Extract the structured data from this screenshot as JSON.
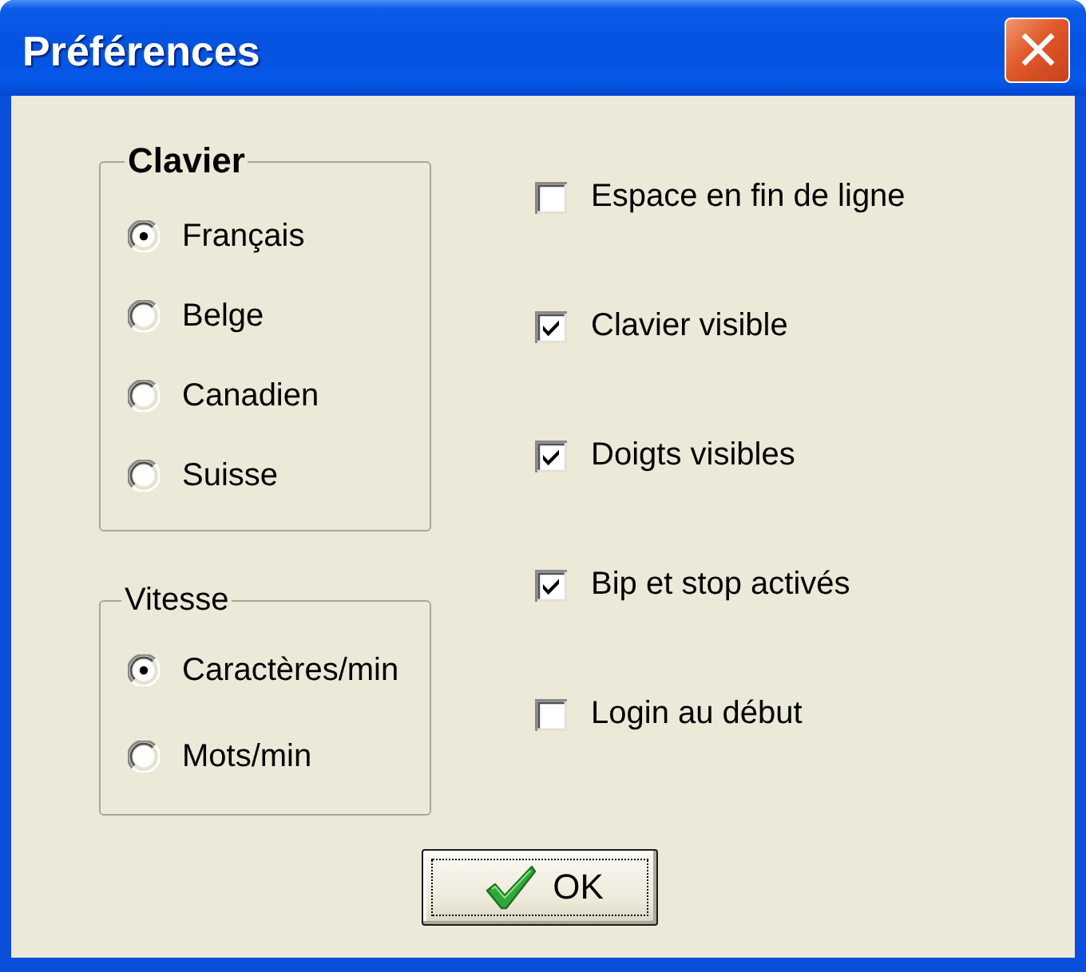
{
  "window": {
    "title": "Préférences"
  },
  "groups": [
    {
      "title": "Clavier",
      "bold": true,
      "options": [
        {
          "label": "Français",
          "selected": true
        },
        {
          "label": "Belge",
          "selected": false
        },
        {
          "label": "Canadien",
          "selected": false
        },
        {
          "label": "Suisse",
          "selected": false
        }
      ]
    },
    {
      "title": "Vitesse",
      "bold": false,
      "options": [
        {
          "label": "Caractères/min",
          "selected": true
        },
        {
          "label": "Mots/min",
          "selected": false
        }
      ]
    }
  ],
  "checkboxes": [
    {
      "label": "Espace en fin de ligne",
      "checked": false
    },
    {
      "label": "Clavier visible",
      "checked": true
    },
    {
      "label": "Doigts visibles",
      "checked": true
    },
    {
      "label": "Bip et stop activés",
      "checked": true
    },
    {
      "label": "Login au début",
      "checked": false
    }
  ],
  "button": {
    "label": "OK",
    "focused": true
  }
}
